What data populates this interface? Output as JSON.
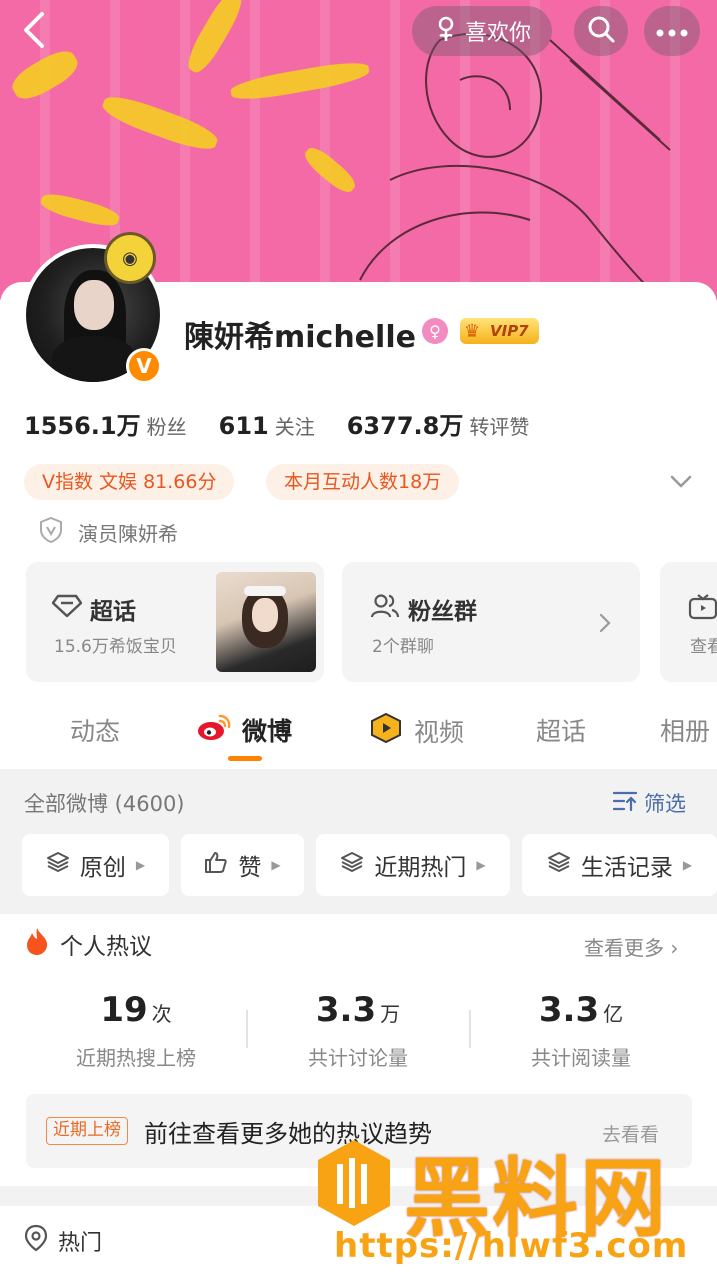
{
  "header": {
    "like_label": "喜欢你"
  },
  "profile": {
    "name": "陳妍希michelle",
    "gender_symbol": "♀",
    "vip_label": "VIP7",
    "verified_badge": "V",
    "stats": [
      {
        "value": "1556.1万",
        "label": "粉丝"
      },
      {
        "value": "611",
        "label": "关注"
      },
      {
        "value": "6377.8万",
        "label": "转评赞"
      }
    ],
    "tags": [
      "V指数 文娱 81.66分",
      "本月互动人数18万"
    ],
    "verification": "演员陳妍希"
  },
  "mini_cards": {
    "supertopic": {
      "title": "超话",
      "subtitle": "15.6万希饭宝贝"
    },
    "fan_group": {
      "title": "粉丝群",
      "subtitle": "2个群聊"
    },
    "partial": {
      "subtitle": "查看"
    }
  },
  "tabs": [
    "动态",
    "微博",
    "视频",
    "超话",
    "相册"
  ],
  "active_tab": "微博",
  "feed": {
    "all_label": "全部微博 (4600)",
    "filter_label": "筛选",
    "chips": [
      "原创",
      "赞",
      "近期热门",
      "生活记录"
    ]
  },
  "hot_discussion": {
    "title": "个人热议",
    "more_label": "查看更多",
    "metrics": [
      {
        "value": "19",
        "unit": "次",
        "label": "近期热搜上榜"
      },
      {
        "value": "3.3",
        "unit": "万",
        "label": "共计讨论量"
      },
      {
        "value": "3.3",
        "unit": "亿",
        "label": "共计阅读量"
      }
    ],
    "trend_tag": "近期上榜",
    "trend_text": "前往查看更多她的热议趋势",
    "trend_action": "去看看"
  },
  "bottom": {
    "hot_label": "热门"
  },
  "watermark": {
    "text": "黑料网",
    "url": "https://hlwf3.com"
  },
  "colors": {
    "banner": "#f36aa6",
    "accent": "#ff8200",
    "tag_text": "#e8571f",
    "link_blue": "#4a6ea9"
  }
}
